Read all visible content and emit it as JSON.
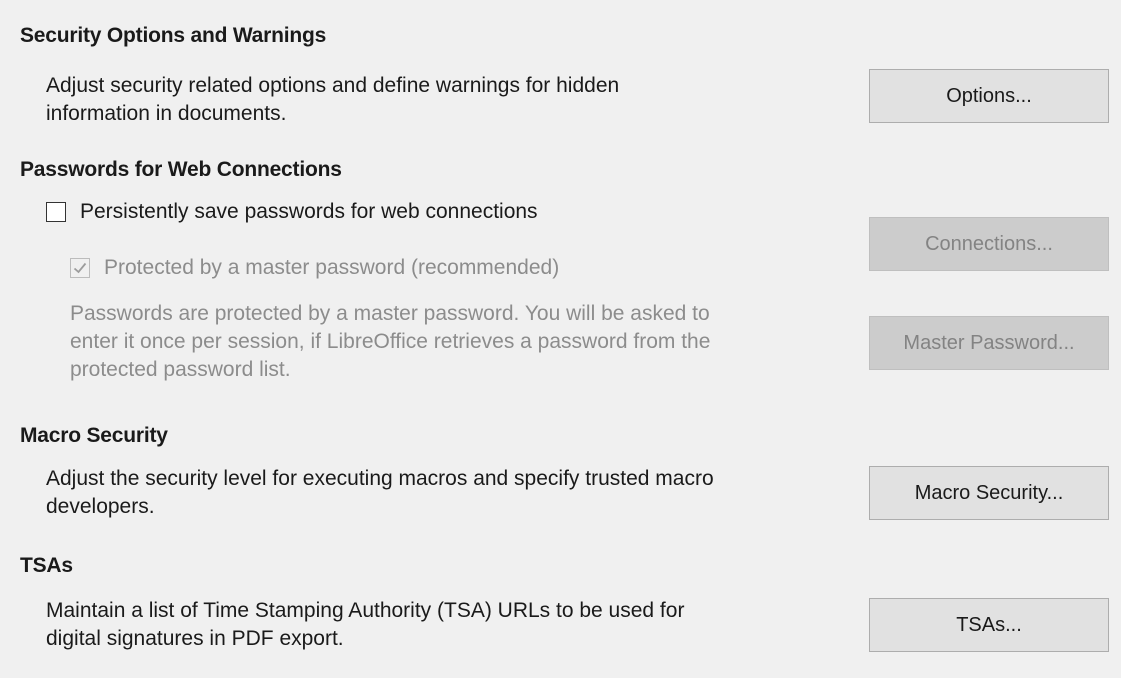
{
  "security_options": {
    "heading": "Security Options and Warnings",
    "description_lines": [
      "Adjust security related options and define warnings for hidden",
      "information in documents."
    ],
    "button_label": "Options..."
  },
  "web_passwords": {
    "heading": "Passwords for Web Connections",
    "persist_checkbox": {
      "label": "Persistently save passwords for web connections",
      "checked": false,
      "enabled": true
    },
    "master_checkbox": {
      "label": "Protected by a master password (recommended)",
      "checked": true,
      "enabled": false
    },
    "note_lines": [
      "Passwords are protected by a master password. You will be asked to",
      "enter it once per session, if LibreOffice retrieves a password from the",
      "protected password list."
    ],
    "connections_button": "Connections...",
    "master_password_button": "Master Password..."
  },
  "macro_security": {
    "heading": "Macro Security",
    "description_lines": [
      "Adjust the security level for executing macros and specify trusted macro",
      "developers."
    ],
    "button_label": "Macro Security..."
  },
  "tsas": {
    "heading": "TSAs",
    "description_lines": [
      "Maintain a list of Time Stamping Authority (TSA) URLs to be used for",
      "digital signatures in PDF export."
    ],
    "button_label": "TSAs..."
  },
  "colors": {
    "background": "#f0f0f0",
    "button": "#e1e1e1",
    "button_disabled": "#cccccc",
    "text_disabled": "#8c8c8c"
  }
}
